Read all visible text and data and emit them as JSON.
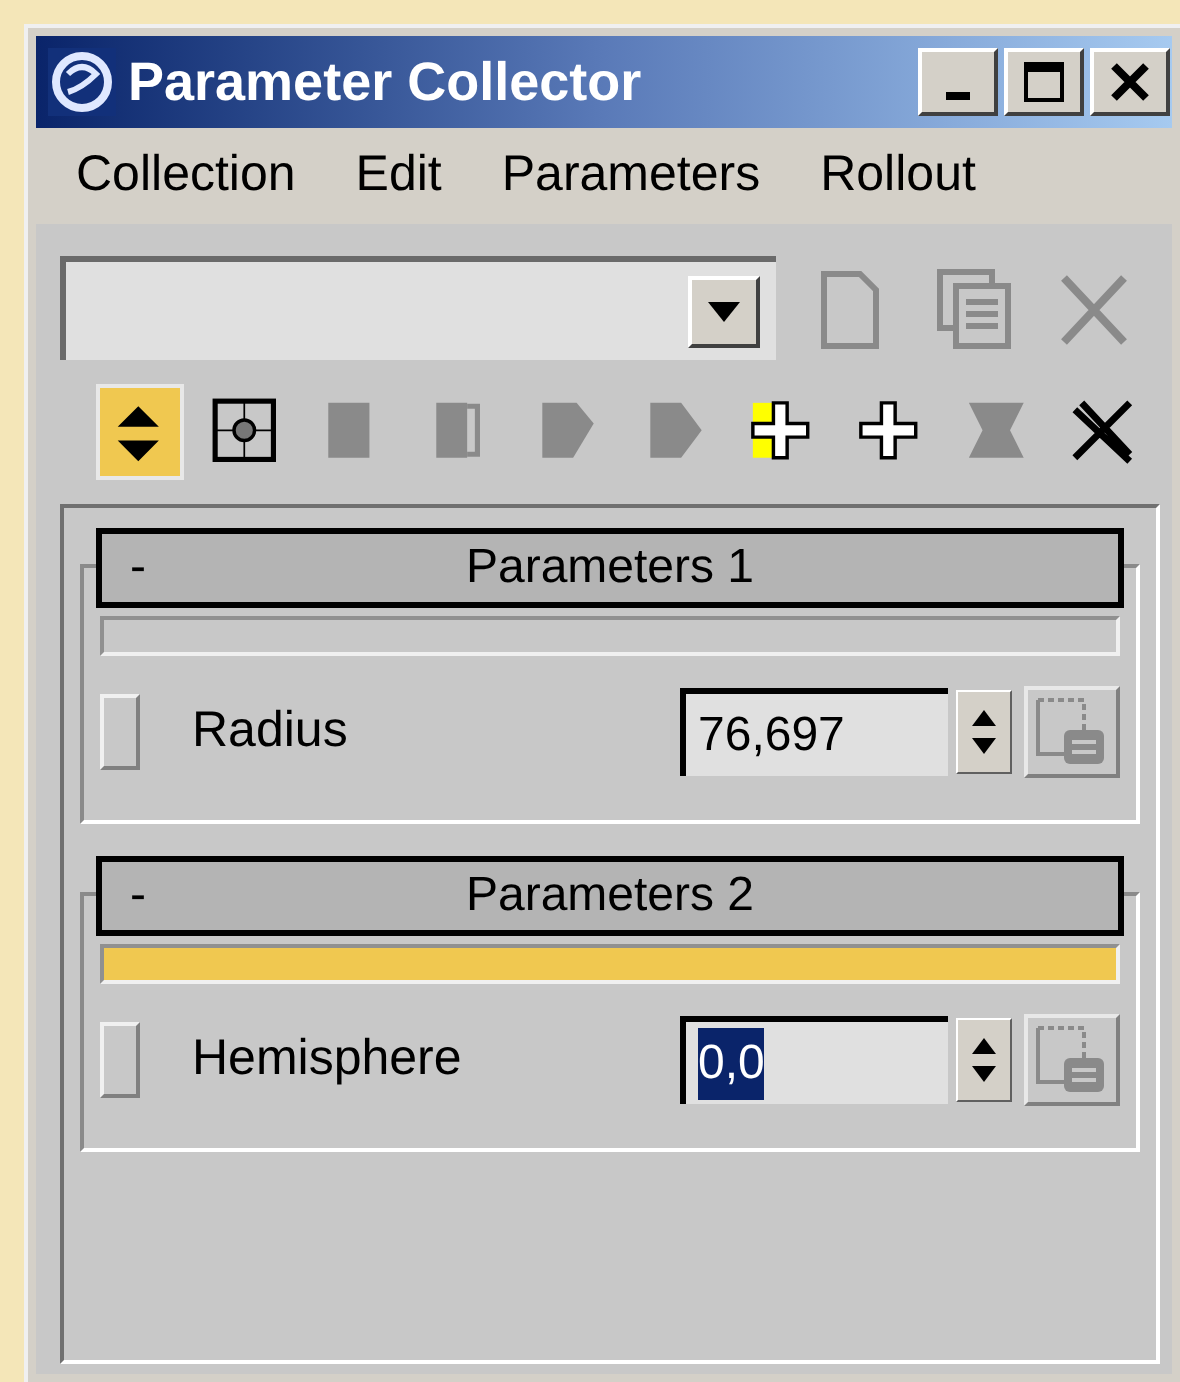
{
  "window": {
    "title": "Parameter Collector",
    "controls": [
      {
        "kind": "minimize"
      },
      {
        "kind": "maximize"
      },
      {
        "kind": "close"
      }
    ]
  },
  "menu": [
    "Collection",
    "Edit",
    "Parameters",
    "Rollout"
  ],
  "collection_tools": [
    {
      "kind": "new",
      "disabled": true
    },
    {
      "kind": "duplicate",
      "disabled": true
    },
    {
      "kind": "delete",
      "disabled": true
    }
  ],
  "toolbar": [
    {
      "kind": "arrows",
      "selected": true,
      "disabled": false
    },
    {
      "kind": "target",
      "selected": false,
      "disabled": false
    },
    {
      "kind": "block",
      "selected": false,
      "disabled": true
    },
    {
      "kind": "block-open",
      "selected": false,
      "disabled": true
    },
    {
      "kind": "block-arrow",
      "selected": false,
      "disabled": true
    },
    {
      "kind": "block-point",
      "selected": false,
      "disabled": true
    },
    {
      "kind": "plus-marked",
      "selected": false,
      "disabled": false
    },
    {
      "kind": "plus",
      "selected": false,
      "disabled": false
    },
    {
      "kind": "cross-block",
      "selected": false,
      "disabled": true
    },
    {
      "kind": "cross",
      "selected": false,
      "disabled": false
    }
  ],
  "rollouts": [
    {
      "toggle": "-",
      "title": "Parameters 1",
      "selected": false,
      "parameters": [
        {
          "label": "Radius",
          "value": "76,697",
          "value_highlighted": false
        }
      ]
    },
    {
      "toggle": "-",
      "title": "Parameters 2",
      "selected": true,
      "parameters": [
        {
          "label": "Hemisphere",
          "value": "0,0",
          "value_highlighted": true
        }
      ]
    }
  ]
}
